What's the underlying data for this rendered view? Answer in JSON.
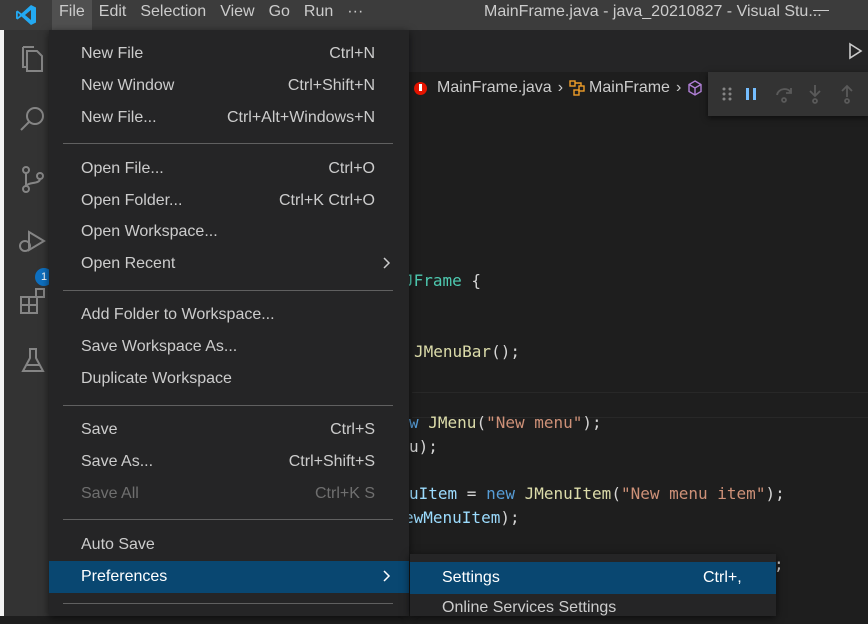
{
  "menubar": {
    "items": [
      "File",
      "Edit",
      "Selection",
      "View",
      "Go",
      "Run",
      "···"
    ],
    "active_index": 0
  },
  "window_title": "MainFrame.java - java_20210827 - Visual Stu...",
  "activity_bar": {
    "icons": [
      "explorer-icon",
      "search-icon",
      "source-control-icon",
      "run-debug-icon",
      "extensions-icon",
      "testing-icon"
    ],
    "debug_badge": "1"
  },
  "breadcrumb": {
    "file": "MainFrame.java",
    "symbol": "MainFrame"
  },
  "code": {
    "line1": {
      "cls": "JFrame",
      "rest": " {"
    },
    "line2": {
      "fn": "JMenuBar",
      "rest": "();"
    },
    "line3": {
      "kw": "w ",
      "fn": "JMenu",
      "open": "(",
      "str": "\"New menu\"",
      "rest": ");"
    },
    "line4": {
      "rest": "u);"
    },
    "line5": {
      "var": "uItem",
      "eq": " = ",
      "kw": "new ",
      "fn": "JMenuItem",
      "open": "(",
      "str": "\"New menu item\"",
      "rest": ");"
    },
    "line6": {
      "var": "ewMenuItem",
      "rest": ");"
    },
    "line7": {
      "rest": ";"
    }
  },
  "file_menu": {
    "new_file": {
      "label": "New File",
      "shortcut": "Ctrl+N"
    },
    "new_window": {
      "label": "New Window",
      "shortcut": "Ctrl+Shift+N"
    },
    "new_file_dots": {
      "label": "New File...",
      "shortcut": "Ctrl+Alt+Windows+N"
    },
    "open_file": {
      "label": "Open File...",
      "shortcut": "Ctrl+O"
    },
    "open_folder": {
      "label": "Open Folder...",
      "shortcut": "Ctrl+K Ctrl+O"
    },
    "open_workspace": {
      "label": "Open Workspace..."
    },
    "open_recent": {
      "label": "Open Recent"
    },
    "add_folder": {
      "label": "Add Folder to Workspace..."
    },
    "save_workspace_as": {
      "label": "Save Workspace As..."
    },
    "duplicate_workspace": {
      "label": "Duplicate Workspace"
    },
    "save": {
      "label": "Save",
      "shortcut": "Ctrl+S"
    },
    "save_as": {
      "label": "Save As...",
      "shortcut": "Ctrl+Shift+S"
    },
    "save_all": {
      "label": "Save All",
      "shortcut": "Ctrl+K S"
    },
    "auto_save": {
      "label": "Auto Save"
    },
    "preferences": {
      "label": "Preferences"
    }
  },
  "preferences_submenu": {
    "settings": {
      "label": "Settings",
      "shortcut": "Ctrl+,"
    },
    "online_services": {
      "label": "Online Services Settings"
    }
  },
  "colors": {
    "accent": "#0e70c0",
    "selection": "#094771",
    "menu_bg": "#252526",
    "titlebar_bg": "#3c3c3c"
  }
}
